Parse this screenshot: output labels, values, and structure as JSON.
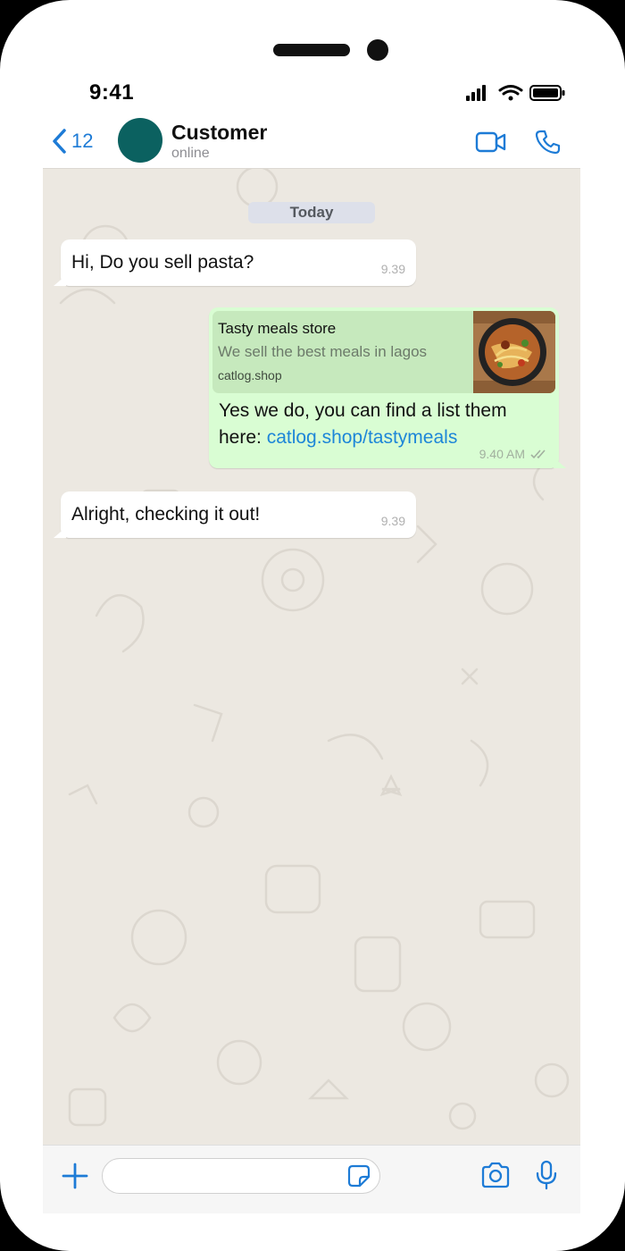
{
  "status_bar": {
    "time": "9:41"
  },
  "header": {
    "back_count": "12",
    "contact_name": "Customer",
    "contact_status": "online"
  },
  "chat": {
    "date_separator": "Today",
    "messages": [
      {
        "direction": "incoming",
        "text": "Hi, Do you sell pasta?",
        "time": "9.39"
      },
      {
        "direction": "outgoing",
        "link_preview": {
          "title": "Tasty meals store",
          "description": "We sell the best meals in lagos",
          "domain": "catlog.shop"
        },
        "text": "Yes we do, you can find a list them here: ",
        "link_text": "catlog.shop/tastymeals",
        "time": "9.40 AM"
      },
      {
        "direction": "incoming",
        "text": "Alright, checking it out!",
        "time": "9.39"
      }
    ]
  },
  "input_bar": {
    "placeholder": ""
  },
  "colors": {
    "accent": "#1d7bd6",
    "avatar": "#0b6160",
    "outgoing_bubble": "#d9fdd3",
    "wallpaper": "#ece8e1"
  },
  "icons": {
    "back": "chevron-left-icon",
    "video": "video-camera-icon",
    "call": "phone-icon",
    "add": "plus-icon",
    "sticker": "sticker-icon",
    "camera": "camera-icon",
    "mic": "microphone-icon",
    "read_receipt": "double-check-icon"
  }
}
